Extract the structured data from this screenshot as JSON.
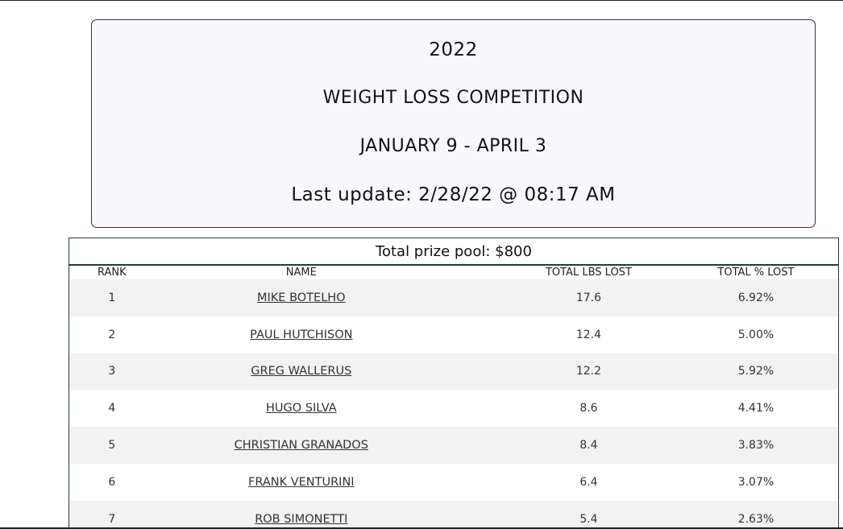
{
  "header": {
    "year": "2022",
    "title": "WEIGHT LOSS COMPETITION",
    "dates": "JANUARY 9 - APRIL 3",
    "last_update": "Last update: 2/28/22 @ 08:17 AM"
  },
  "table": {
    "prize_pool": "Total prize pool: $800",
    "columns": [
      "RANK",
      "NAME",
      "TOTAL LBS LOST",
      "TOTAL % LOST"
    ],
    "rows": [
      {
        "rank": "1",
        "name": "MIKE BOTELHO",
        "lbs": "17.6",
        "pct": "6.92%"
      },
      {
        "rank": "2",
        "name": "PAUL HUTCHISON",
        "lbs": "12.4",
        "pct": "5.00%"
      },
      {
        "rank": "3",
        "name": "GREG WALLERUS",
        "lbs": "12.2",
        "pct": "5.92%"
      },
      {
        "rank": "4",
        "name": "HUGO SILVA",
        "lbs": "8.6",
        "pct": "4.41%"
      },
      {
        "rank": "5",
        "name": "CHRISTIAN GRANADOS",
        "lbs": "8.4",
        "pct": "3.83%"
      },
      {
        "rank": "6",
        "name": "FRANK VENTURINI",
        "lbs": "6.4",
        "pct": "3.07%"
      },
      {
        "rank": "7",
        "name": "ROB SIMONETTI",
        "lbs": "5.4",
        "pct": "2.63%"
      }
    ]
  }
}
